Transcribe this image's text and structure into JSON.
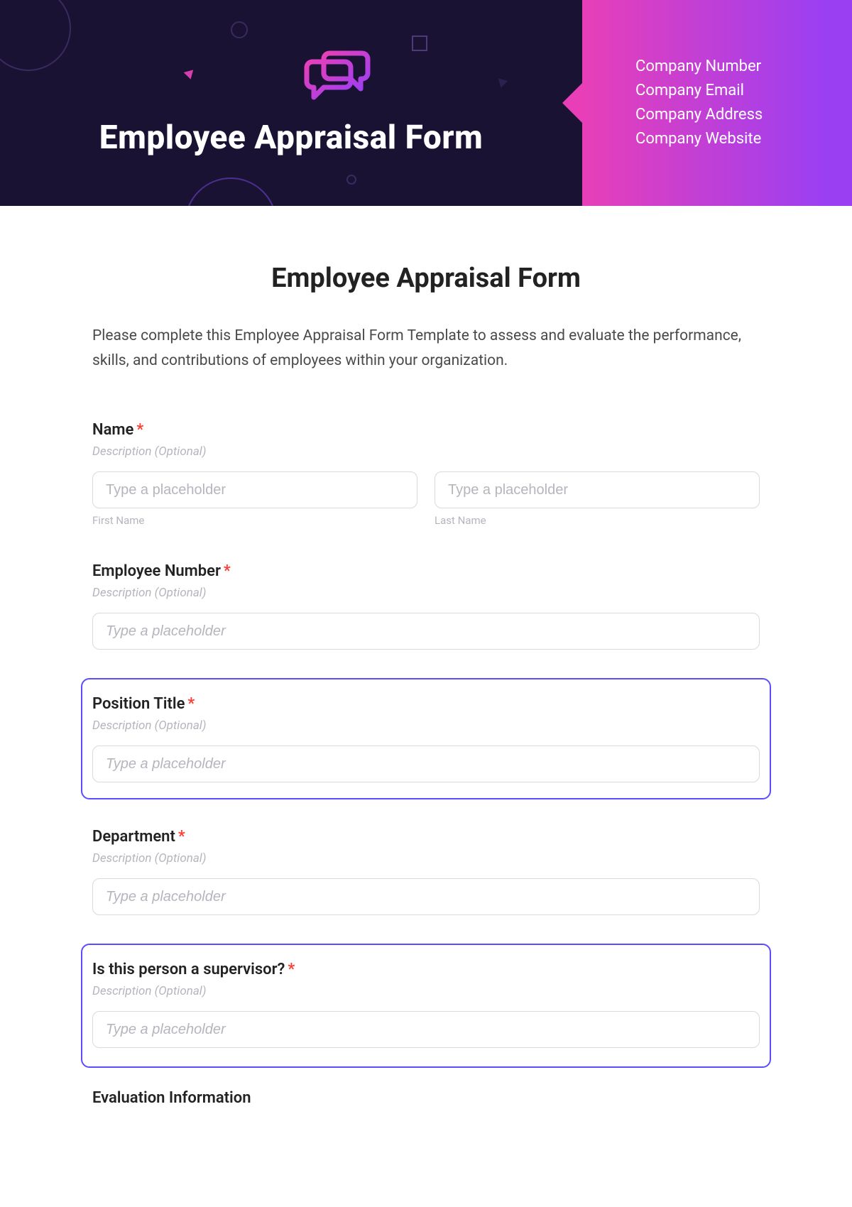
{
  "banner": {
    "title": "Employee Appraisal Form",
    "icon": "chat-bubbles-icon",
    "company_lines": [
      "Company Number",
      "Company Email",
      "Company Address",
      "Company Website"
    ]
  },
  "form": {
    "title": "Employee Appraisal Form",
    "description": "Please complete this Employee Appraisal Form Template to assess and evaluate the performance, skills, and contributions of employees within your organization.",
    "required_mark": "*",
    "optional_desc": "Description (Optional)",
    "placeholder_short": "Type a placeholder",
    "placeholder_long": "Type a placeholder",
    "fields": {
      "name": {
        "label": "Name",
        "first_sub": "First Name",
        "last_sub": "Last Name"
      },
      "employee_number": {
        "label": "Employee Number"
      },
      "position_title": {
        "label": "Position Title"
      },
      "department": {
        "label": "Department"
      },
      "supervisor_q": {
        "label": "Is this person a supervisor?"
      }
    },
    "section_eval": "Evaluation Information"
  }
}
